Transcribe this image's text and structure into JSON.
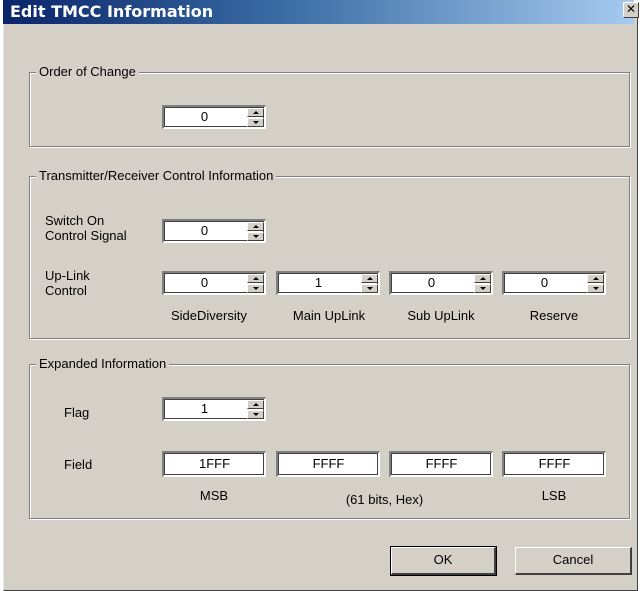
{
  "dialog": {
    "title": "Edit TMCC Information",
    "close_glyph": "✕"
  },
  "order_of_change": {
    "group_label": "Order of Change",
    "value": "0"
  },
  "tx_rx_control": {
    "group_label": "Transmitter/Receiver Control Information",
    "switch_on_label_line1": "Switch On",
    "switch_on_label_line2": "Control Signal",
    "switch_on_value": "0",
    "uplink_label_line1": "Up-Link",
    "uplink_label_line2": "Control",
    "uplink": [
      {
        "value": "0",
        "caption": "SideDiversity"
      },
      {
        "value": "1",
        "caption": "Main UpLink"
      },
      {
        "value": "0",
        "caption": "Sub UpLink"
      },
      {
        "value": "0",
        "caption": "Reserve"
      }
    ]
  },
  "expanded": {
    "group_label": "Expanded Information",
    "flag_label": "Flag",
    "flag_value": "1",
    "field_label": "Field",
    "fields": [
      "1FFF",
      "FFFF",
      "FFFF",
      "FFFF"
    ],
    "caption_msb": "MSB",
    "caption_middle": "(61 bits, Hex)",
    "caption_lsb": "LSB"
  },
  "buttons": {
    "ok": "OK",
    "cancel": "Cancel"
  }
}
